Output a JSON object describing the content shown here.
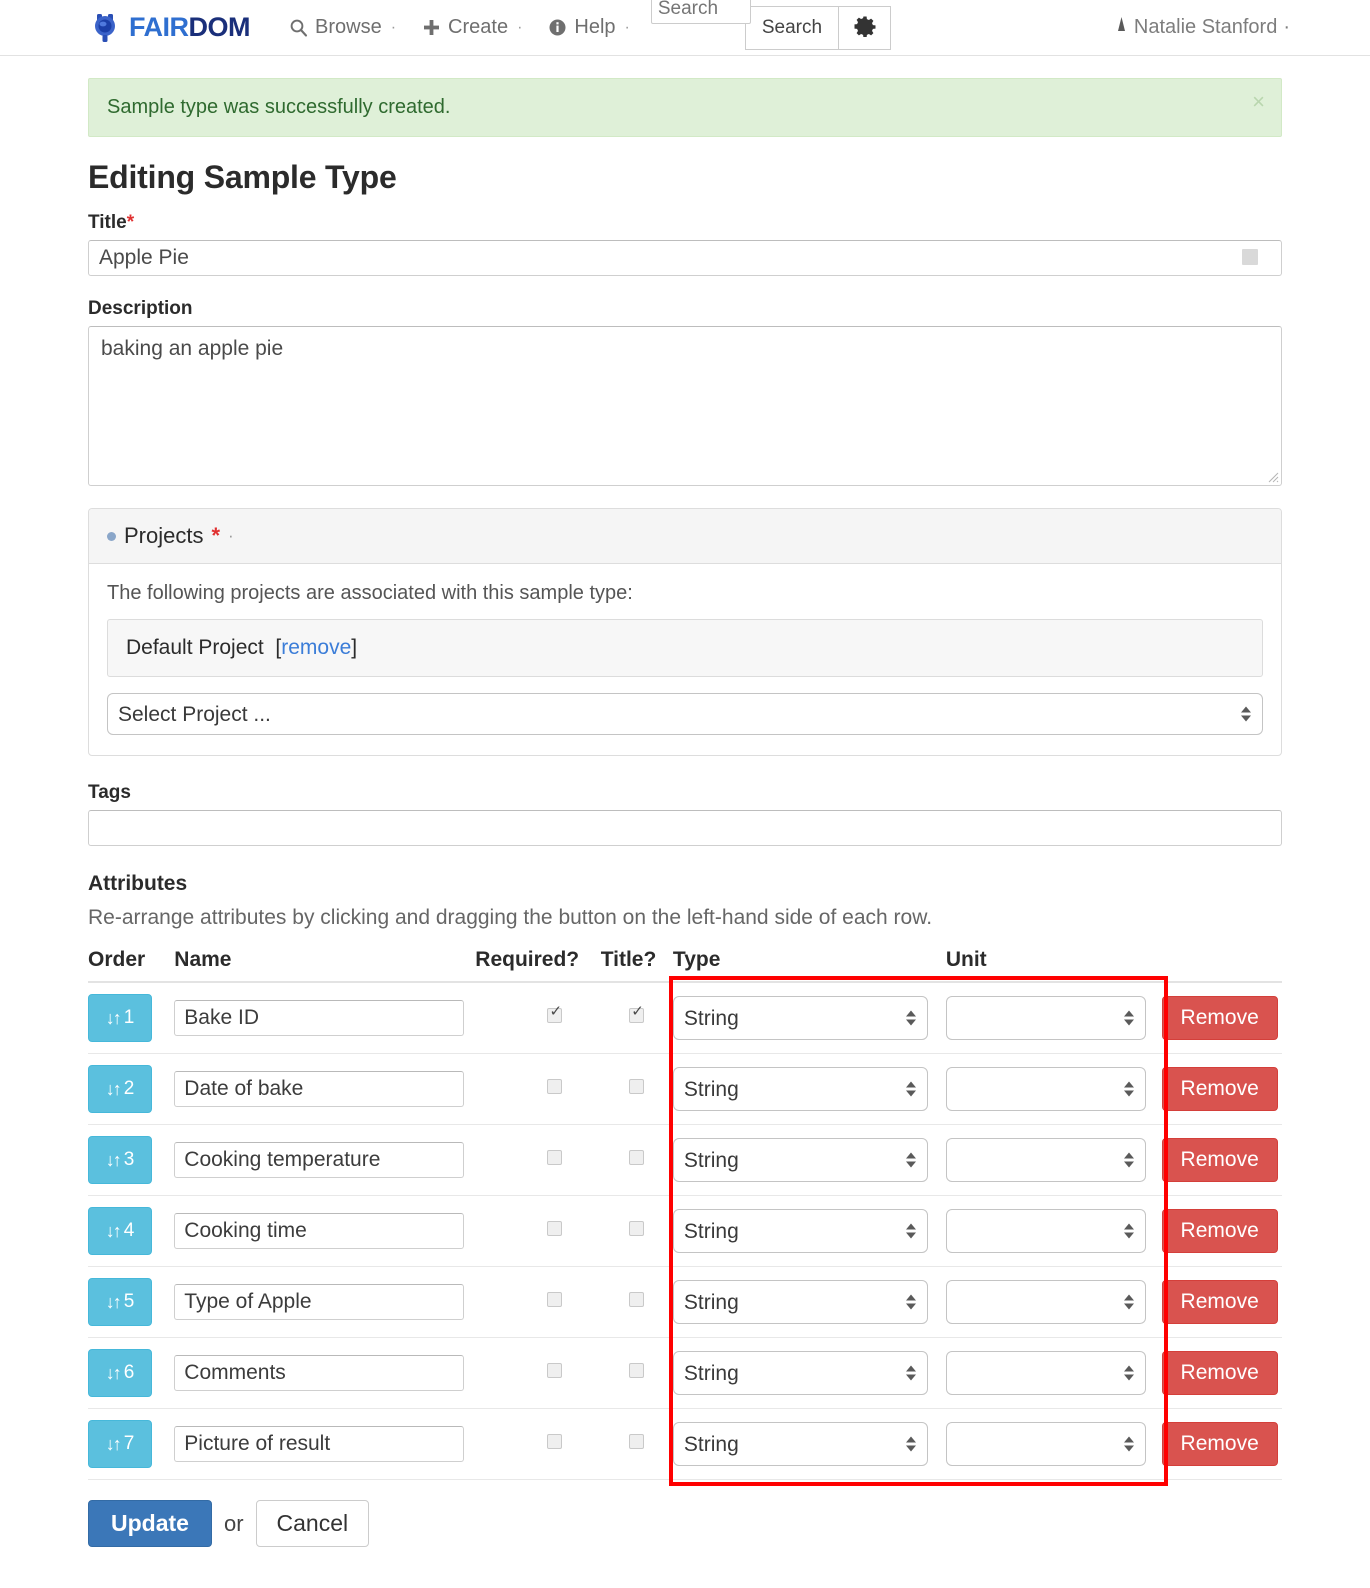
{
  "navbar": {
    "brand": {
      "fair": "FAIR",
      "dom": "DOM",
      "logo_icon": "fairdom-globe-logo"
    },
    "items": [
      {
        "label": "Browse",
        "icon": "search-icon",
        "caret": "·"
      },
      {
        "label": "Create",
        "icon": "plus-icon",
        "caret": "·"
      },
      {
        "label": "Help",
        "icon": "info-circle-icon",
        "caret": "·"
      }
    ],
    "search": {
      "placeholder": "Search",
      "value": "",
      "button_label": "Search",
      "gear_icon": "gear-icon"
    },
    "user": {
      "name": "Natalie Stanford",
      "icon": "user-icon",
      "caret": "·"
    }
  },
  "alert": {
    "message": "Sample type was successfully created.",
    "close_label": "×",
    "bg_color": "#dff0d8",
    "text_color": "#2f6a2f"
  },
  "page": {
    "title": "Editing Sample Type"
  },
  "form": {
    "title_field": {
      "label": "Title",
      "required_mark": "*",
      "value": "Apple Pie",
      "placeholder": ""
    },
    "description_field": {
      "label": "Description",
      "value": "baking an apple pie",
      "placeholder": ""
    },
    "projects_panel": {
      "heading": "Projects",
      "required_mark": "*",
      "trailing_dots": "·",
      "note": "The following projects are associated with this sample type:",
      "associated": [
        {
          "name": "Default Project",
          "remove_label": "remove",
          "bracket_open": "[",
          "bracket_close": "]"
        }
      ],
      "select": {
        "selected": "Select Project ...",
        "options": [
          "Select Project ..."
        ]
      }
    },
    "tags_field": {
      "label": "Tags",
      "value": "",
      "placeholder": ""
    }
  },
  "attributes_section": {
    "heading": "Attributes",
    "note": "Re-arrange attributes by clicking and dragging the button on the left-hand side of each row.",
    "columns": [
      "Order",
      "Name",
      "Required?",
      "Title?",
      "Type",
      "Unit"
    ],
    "remove_label": "Remove",
    "drag_icon": "sort-updown-icon",
    "type_options": [
      "String"
    ],
    "unit_options": [
      ""
    ],
    "rows": [
      {
        "order": "1",
        "name": "Bake ID",
        "required": true,
        "title": true,
        "type": "String",
        "unit": ""
      },
      {
        "order": "2",
        "name": "Date of bake",
        "required": false,
        "title": false,
        "type": "String",
        "unit": ""
      },
      {
        "order": "3",
        "name": "Cooking temperature",
        "required": false,
        "title": false,
        "type": "String",
        "unit": ""
      },
      {
        "order": "4",
        "name": "Cooking time",
        "required": false,
        "title": false,
        "type": "String",
        "unit": ""
      },
      {
        "order": "5",
        "name": "Type of Apple",
        "required": false,
        "title": false,
        "type": "String",
        "unit": ""
      },
      {
        "order": "6",
        "name": "Comments",
        "required": false,
        "title": false,
        "type": "String",
        "unit": ""
      },
      {
        "order": "7",
        "name": "Picture of result",
        "required": false,
        "title": false,
        "type": "String",
        "unit": ""
      }
    ],
    "highlight": {
      "color": "#ff0000",
      "covers": "Type and Unit columns"
    }
  },
  "actions": {
    "update_label": "Update",
    "or_label": "or",
    "cancel_label": "Cancel",
    "update_color": "#3b77b8"
  }
}
